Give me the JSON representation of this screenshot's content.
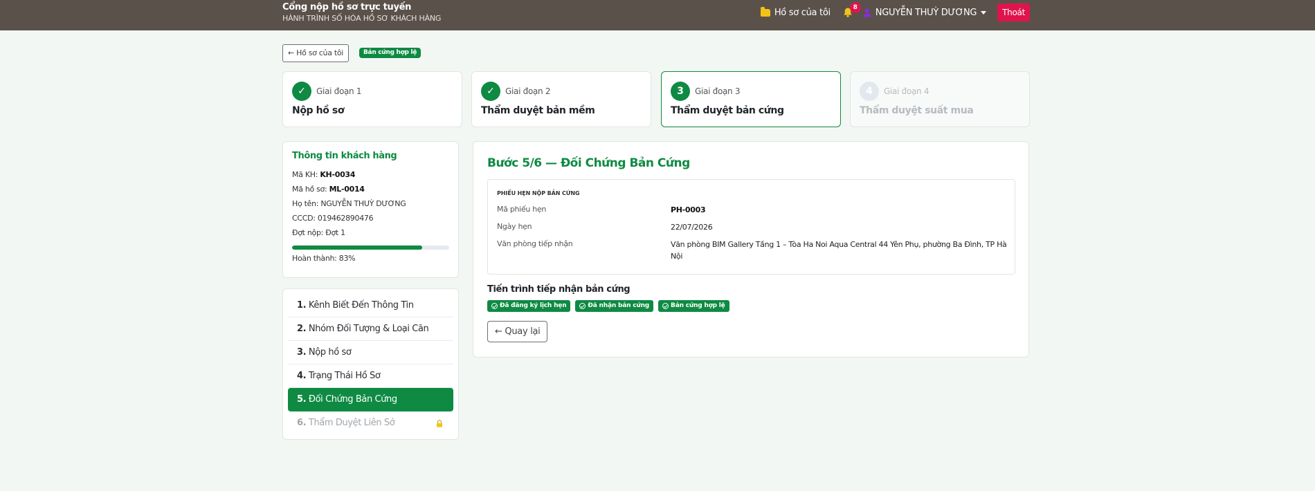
{
  "header": {
    "title": "Cổng nộp hồ sơ trực tuyến",
    "subtitle": "HÀNH TRÌNH SỐ HÓA HỒ SƠ KHÁCH HÀNG",
    "my_files_label": "Hồ sơ của tôi",
    "notification_count": "8",
    "user_name": "NGUYỄN THUỲ DƯƠNG",
    "logout_label": "Thoát"
  },
  "subbar": {
    "back_label": "← Hồ sơ của tôi",
    "status_badge": "Bản cứng hợp lệ"
  },
  "stages": [
    {
      "number": "✓",
      "phase": "Giai đoạn 1",
      "title": "Nộp hồ sơ",
      "state": "done"
    },
    {
      "number": "✓",
      "phase": "Giai đoạn 2",
      "title": "Thẩm duyệt bản mềm",
      "state": "done"
    },
    {
      "number": "3",
      "phase": "Giai đoạn 3",
      "title": "Thẩm duyệt bản cứng",
      "state": "active"
    },
    {
      "number": "4",
      "phase": "Giai đoạn 4",
      "title": "Thẩm duyệt suất mua",
      "state": "disabled"
    }
  ],
  "customer": {
    "title": "Thông tin khách hàng",
    "rows": [
      {
        "label": "Mã KH:",
        "value": "KH-0034",
        "strong": true
      },
      {
        "label": "Mã hồ sơ:",
        "value": "ML-0014",
        "strong": true
      },
      {
        "label": "Họ tên:",
        "value": "NGUYỄN THUỲ DƯƠNG",
        "strong": false
      },
      {
        "label": "CCCD:",
        "value": "019462890476",
        "strong": false
      },
      {
        "label": "Đợt nộp:",
        "value": "Đợt 1",
        "strong": false
      }
    ],
    "progress_percent": 83,
    "progress_label": "Hoàn thành: 83%"
  },
  "steps": [
    {
      "num": "1.",
      "label": "Kênh Biết Đến Thông Tin",
      "state": "normal"
    },
    {
      "num": "2.",
      "label": "Nhóm Đối Tượng & Loại Căn",
      "state": "normal"
    },
    {
      "num": "3.",
      "label": "Nộp hồ sơ",
      "state": "normal"
    },
    {
      "num": "4.",
      "label": "Trạng Thái Hồ Sơ",
      "state": "normal"
    },
    {
      "num": "5.",
      "label": "Đối Chứng Bản Cứng",
      "state": "active"
    },
    {
      "num": "6.",
      "label": "Thẩm Duyệt Liên Sở",
      "state": "locked"
    }
  ],
  "main": {
    "title": "Bước 5/6 — Đối Chứng Bản Cứng",
    "ticket": {
      "heading": "PHIẾU HẸN NỘP BẢN CỨNG",
      "rows": [
        {
          "label": "Mã phiếu hẹn",
          "value": "PH-0003"
        },
        {
          "label": "Ngày hẹn",
          "value": "22/07/2026"
        },
        {
          "label": "Văn phòng tiếp nhận",
          "value": "Văn phòng BIM Gallery Tầng 1 – Tòa Ha Noi Aqua Central 44 Yên Phụ, phường Ba Đình, TP Hà Nội"
        }
      ]
    },
    "progress_title": "Tiến trình tiếp nhận bản cứng",
    "chips": [
      "Đã đăng ký lịch hẹn",
      "Đã nhận bản cứng",
      "Bản cứng hợp lệ"
    ],
    "back_label": "← Quay lại"
  },
  "colors": {
    "topbar": "#5b514b",
    "primary_green": "#0e8a43",
    "danger": "#e0144c",
    "page_bg": "#f3f7f3"
  }
}
